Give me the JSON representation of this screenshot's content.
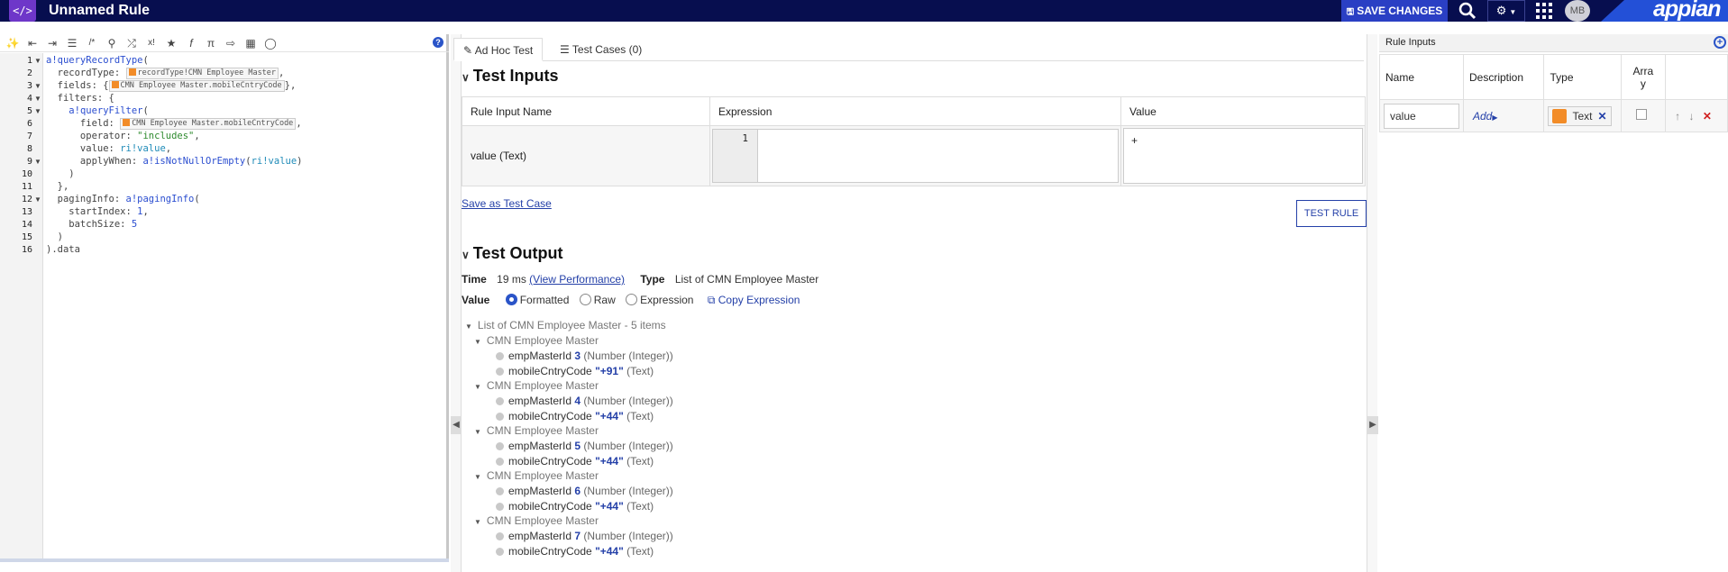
{
  "topbar": {
    "logo_glyph": "</>",
    "title": "Unnamed Rule",
    "save_label": "SAVE CHANGES",
    "avatar": "MB",
    "brand": "appian"
  },
  "editor": {
    "line_numbers": [
      "1",
      "2",
      "3",
      "4",
      "5",
      "6",
      "7",
      "8",
      "9",
      "10",
      "11",
      "12",
      "13",
      "14",
      "15",
      "16"
    ],
    "tokens": {
      "record_type": "recordType!CMN Employee Master",
      "field_ref": "CMN Employee Master.mobileCntryCode"
    }
  },
  "tabs": {
    "adhoc": "Ad Hoc Test",
    "cases": "Test Cases (0)"
  },
  "test_inputs": {
    "title": "Test Inputs",
    "headers": [
      "Rule Input Name",
      "Expression",
      "Value"
    ],
    "row_name": "value (Text)",
    "expr_line": "1",
    "value": "+",
    "save_case": "Save as Test Case",
    "test_button": "TEST RULE"
  },
  "test_output": {
    "title": "Test Output",
    "time_label": "Time",
    "time_value": "19 ms",
    "view_perf": "(View Performance)",
    "type_label": "Type",
    "type_value": "List of CMN Employee Master",
    "value_label": "Value",
    "radio_formatted": "Formatted",
    "radio_raw": "Raw",
    "radio_expression": "Expression",
    "copy_expression": "Copy Expression",
    "list_title": "List of CMN Employee Master - 5 items",
    "items": [
      {
        "label": "CMN Employee Master",
        "id": "3",
        "code": "\"+91\""
      },
      {
        "label": "CMN Employee Master",
        "id": "4",
        "code": "\"+44\""
      },
      {
        "label": "CMN Employee Master",
        "id": "5",
        "code": "\"+44\""
      },
      {
        "label": "CMN Employee Master",
        "id": "6",
        "code": "\"+44\""
      },
      {
        "label": "CMN Employee Master",
        "id": "7",
        "code": "\"+44\""
      }
    ],
    "field_id": "empMasterId",
    "field_code": "mobileCntryCode",
    "type_int": "(Number (Integer))",
    "type_text": "(Text)"
  },
  "rule_inputs": {
    "title": "Rule Inputs",
    "headers": [
      "Name",
      "Description",
      "Type",
      "Arra\ny"
    ],
    "row": {
      "name": "value",
      "description": "Add",
      "type": "Text"
    }
  }
}
